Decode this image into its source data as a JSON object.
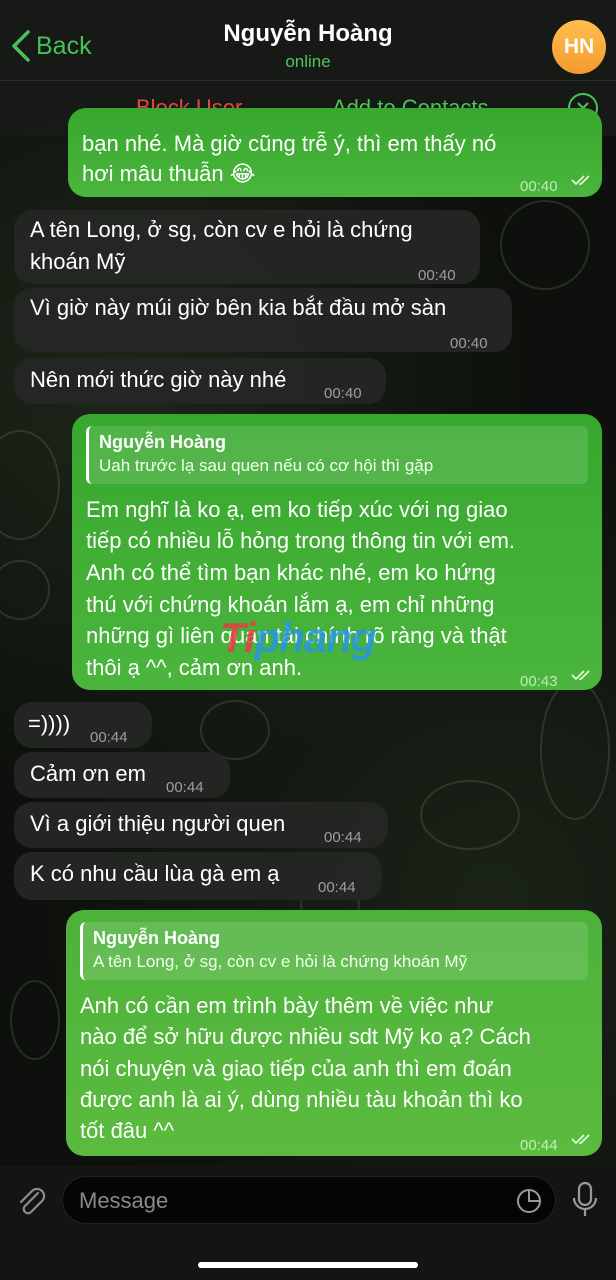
{
  "header": {
    "back_label": "Back",
    "title": "Nguyễn Hoàng",
    "status": "online",
    "avatar_initials": "HN"
  },
  "actions": {
    "block_label": "Block User",
    "add_label": "Add to Contacts"
  },
  "messages": [
    {
      "dir": "out",
      "lines": [
        "bạn nhé. Mà giờ cũng trễ ý, thì em thấy nó",
        "hơi mâu thuẫn 😂"
      ],
      "time": "00:40",
      "read": true
    },
    {
      "dir": "in",
      "lines": [
        "A tên Long, ở sg, còn cv e hỏi là chứng",
        "khoán Mỹ"
      ],
      "time": "00:40"
    },
    {
      "dir": "in",
      "lines": [
        "Vì giờ này múi giờ bên kia bắt đầu mở sàn"
      ],
      "time": "00:40"
    },
    {
      "dir": "in",
      "lines": [
        "Nên mới thức giờ này nhé"
      ],
      "time": "00:40"
    },
    {
      "dir": "out",
      "reply_name": "Nguyễn Hoàng",
      "reply_text": "Uah trước lạ sau quen nếu có cơ hội thì gặp",
      "lines": [
        "Em nghĩ là ko ạ, em ko tiếp xúc với ng giao",
        "tiếp có nhiều lỗ hỏng trong thông tin với em.",
        "Anh có thể tìm bạn khác nhé, em ko hứng",
        "thú với chứng khoán lắm ạ, em chỉ những",
        "những gì liên quan tài chính rõ ràng và thật",
        "thôi ạ ^^, cảm ơn anh."
      ],
      "time": "00:43",
      "read": true
    },
    {
      "dir": "in",
      "lines": [
        "=))))"
      ],
      "time": "00:44"
    },
    {
      "dir": "in",
      "lines": [
        "Cảm ơn em"
      ],
      "time": "00:44"
    },
    {
      "dir": "in",
      "lines": [
        "Vì a giới thiệu người quen"
      ],
      "time": "00:44"
    },
    {
      "dir": "in",
      "lines": [
        "K có nhu cầu lùa gà em ạ"
      ],
      "time": "00:44"
    },
    {
      "dir": "out",
      "reply_name": "Nguyễn Hoàng",
      "reply_text": "A tên Long, ở sg, còn cv e hỏi là chứng khoán Mỹ",
      "lines": [
        "Anh có cần em trình bày thêm về việc như",
        "nào để sở hữu được nhiều sdt Mỹ ko ạ? Cách",
        "nói chuyện và giao tiếp của anh thì em đoán",
        "được anh là ai ý, dùng nhiều tàu khoản thì ko",
        "tốt đâu ^^"
      ],
      "time": "00:44",
      "read": true
    }
  ],
  "watermark": {
    "part1": "Ti",
    "part2": "phang"
  },
  "input": {
    "placeholder": "Message"
  },
  "icons": {
    "back": "chevron-left-icon",
    "close": "close-circle-icon",
    "attach": "paperclip-icon",
    "sticker": "sticker-icon",
    "mic": "microphone-icon",
    "read": "double-check-icon"
  },
  "colors": {
    "accent": "#47c45a",
    "danger": "#e5493f",
    "outgoing": "#3fae33",
    "incoming": "#242624"
  }
}
